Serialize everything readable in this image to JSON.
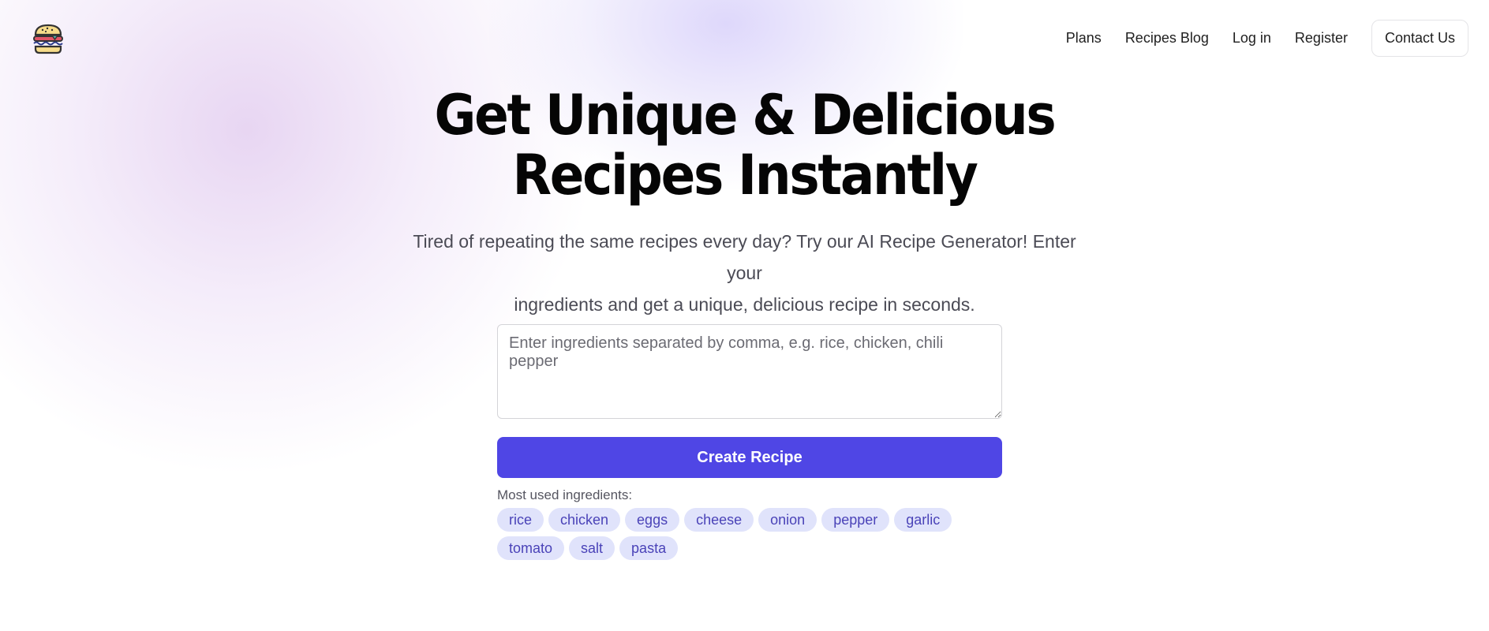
{
  "header": {
    "logo": "burger-logo",
    "nav": [
      {
        "label": "Plans"
      },
      {
        "label": "Recipes Blog"
      },
      {
        "label": "Log in"
      },
      {
        "label": "Register"
      }
    ],
    "contact_label": "Contact Us"
  },
  "hero": {
    "title_line1": "Get Unique & Delicious",
    "title_line2": "Recipes Instantly",
    "subtitle_line1": "Tired of repeating the same recipes every day? Try our AI Recipe Generator! Enter your",
    "subtitle_line2": "ingredients and get a unique, delicious recipe in seconds."
  },
  "form": {
    "ingredients_value": "",
    "ingredients_placeholder": "Enter ingredients separated by comma, e.g. rice, chicken, chili pepper",
    "create_label": "Create Recipe",
    "most_used_label": "Most used ingredients:",
    "chips": [
      "rice",
      "chicken",
      "eggs",
      "cheese",
      "onion",
      "pepper",
      "garlic",
      "tomato",
      "salt",
      "pasta"
    ]
  },
  "colors": {
    "accent": "#4f46e5",
    "chip_bg": "#e0e3fb",
    "chip_text": "#4a43b8"
  }
}
